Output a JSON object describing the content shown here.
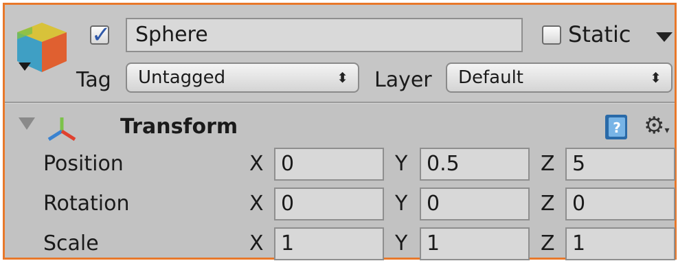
{
  "object": {
    "active": true,
    "name": "Sphere",
    "static_label": "Static",
    "static_checked": false,
    "tag_label": "Tag",
    "tag_value": "Untagged",
    "layer_label": "Layer",
    "layer_value": "Default"
  },
  "transform": {
    "title": "Transform",
    "rows": [
      {
        "label": "Position",
        "x": "0",
        "y": "0.5",
        "z": "5"
      },
      {
        "label": "Rotation",
        "x": "0",
        "y": "0",
        "z": "0"
      },
      {
        "label": "Scale",
        "x": "1",
        "y": "1",
        "z": "1"
      }
    ],
    "axis_labels": {
      "x": "X",
      "y": "Y",
      "z": "Z"
    }
  },
  "icons": {
    "gameobject": "cube-icon",
    "transform": "axes-icon",
    "help": "help-book-icon",
    "settings": "gear-icon"
  },
  "colors": {
    "frame_border": "#e8782a",
    "panel_bg": "#c2c2c2",
    "check_tick": "#2f58a8"
  }
}
